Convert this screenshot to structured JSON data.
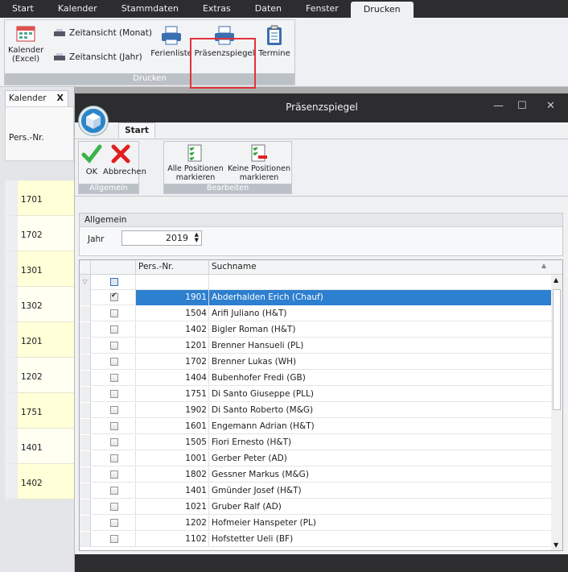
{
  "menubar": {
    "items": [
      "Start",
      "Kalender",
      "Stammdaten",
      "Extras",
      "Daten",
      "Fenster",
      "Drucken"
    ],
    "active": "Drucken"
  },
  "ribbon": {
    "group_caption": "Drucken",
    "kalender_excel": "Kalender\n(Excel)",
    "zeit_monat": "Zeitansicht (Monat)",
    "zeit_jahr": "Zeitansicht (Jahr)",
    "ferienliste": "Ferienliste",
    "praesenz": "Präsenzspiegel",
    "termine": "Termine"
  },
  "left": {
    "tab": "Kalender",
    "close": "X",
    "header": "Pers.-Nr.",
    "rows": [
      "1701",
      "1702",
      "1301",
      "1302",
      "1201",
      "1202",
      "1751",
      "1401",
      "1402"
    ]
  },
  "dialog": {
    "title": "Präsenzspiegel",
    "tab": "Start",
    "ok": "OK",
    "cancel": "Abbrechen",
    "group1": "Allgemein",
    "all_pos": "Alle Positionen\nmarkieren",
    "no_pos": "Keine Positionen\nmarkieren",
    "group2": "Bearbeiten",
    "section": "Allgemein",
    "jahr_label": "Jahr",
    "jahr_value": "2019",
    "col_nr": "Pers.-Nr.",
    "col_name": "Suchname",
    "rows": [
      {
        "nr": "1901",
        "name": "Abderhalden Erich (Chauf)",
        "checked": true,
        "selected": true
      },
      {
        "nr": "1504",
        "name": "Arifi Juliano (H&T)"
      },
      {
        "nr": "1402",
        "name": "Bigler Roman (H&T)"
      },
      {
        "nr": "1201",
        "name": "Brenner Hansueli (PL)"
      },
      {
        "nr": "1702",
        "name": "Brenner Lukas (WH)"
      },
      {
        "nr": "1404",
        "name": "Bubenhofer Fredi (GB)"
      },
      {
        "nr": "1751",
        "name": "Di Santo Giuseppe (PLL)"
      },
      {
        "nr": "1902",
        "name": "Di Santo Roberto (M&G)"
      },
      {
        "nr": "1601",
        "name": "Engemann Adrian (H&T)"
      },
      {
        "nr": "1505",
        "name": "Fiori Ernesto (H&T)"
      },
      {
        "nr": "1001",
        "name": "Gerber Peter (AD)"
      },
      {
        "nr": "1802",
        "name": "Gessner Markus (M&G)"
      },
      {
        "nr": "1401",
        "name": "Gmünder Josef (H&T)"
      },
      {
        "nr": "1021",
        "name": "Gruber Ralf (AD)"
      },
      {
        "nr": "1202",
        "name": "Hofmeier Hanspeter (PL)"
      },
      {
        "nr": "1102",
        "name": "Hofstetter Ueli (BF)"
      }
    ]
  }
}
